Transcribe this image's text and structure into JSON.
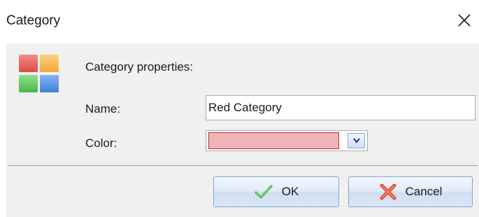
{
  "window": {
    "title": "Category",
    "close_icon": "close-icon"
  },
  "form": {
    "heading": "Category properties:",
    "name_label": "Name:",
    "name_value": "Red Category",
    "color_label": "Color:",
    "color_value": "#f0b4b9",
    "color_border": "#b03030"
  },
  "buttons": {
    "ok_label": "OK",
    "ok_icon": "checkmark-icon",
    "cancel_label": "Cancel",
    "cancel_icon": "cross-icon"
  },
  "colors": {
    "body_background": "#f0f0f0",
    "button_border": "#7ea6d4",
    "category_icon_red": "#e85a5a",
    "category_icon_orange": "#f6b34a",
    "category_icon_green": "#5bc85b",
    "category_icon_blue": "#4f8de4"
  }
}
